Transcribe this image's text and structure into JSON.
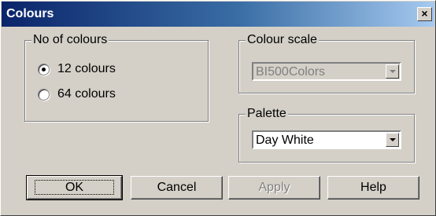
{
  "window": {
    "title": "Colours",
    "close_label": "×"
  },
  "no_of_colours": {
    "legend": "No of colours",
    "options": [
      {
        "label": "12 colours",
        "checked": true
      },
      {
        "label": "64 colours",
        "checked": false
      }
    ]
  },
  "colour_scale": {
    "legend": "Colour scale",
    "value": "BI500Colors",
    "enabled": false
  },
  "palette": {
    "legend": "Palette",
    "value": "Day White",
    "enabled": true
  },
  "buttons": {
    "ok": "OK",
    "cancel": "Cancel",
    "apply": "Apply",
    "help": "Help"
  }
}
